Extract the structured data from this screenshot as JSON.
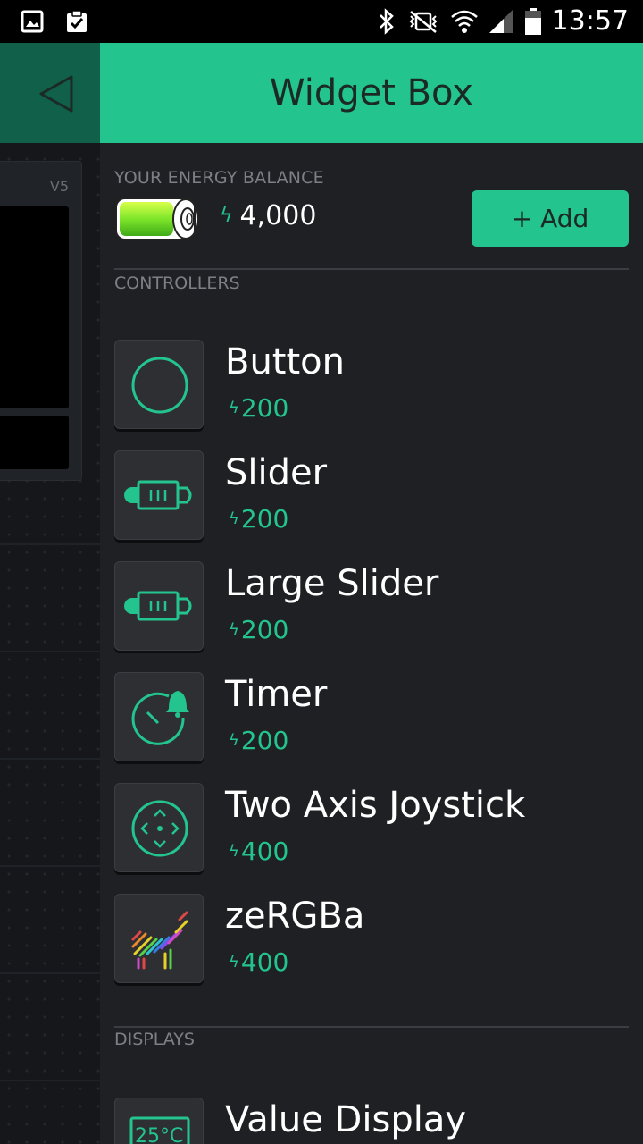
{
  "status_bar": {
    "time": "13:57",
    "icons": [
      "gallery-icon",
      "clipboard-check-icon",
      "bluetooth-icon",
      "vibrate-mute-icon",
      "wifi-icon",
      "signal-icon",
      "battery-icon"
    ]
  },
  "background_dashboard": {
    "pin_label": "V5"
  },
  "panel": {
    "title": "Widget Box",
    "energy": {
      "label": "YOUR ENERGY BALANCE",
      "value": "4,000",
      "add_label": "+ Add"
    },
    "controllers": {
      "label": "CONTROLLERS",
      "items": [
        {
          "name": "Button",
          "cost": "200",
          "icon": "circle-button-icon"
        },
        {
          "name": "Slider",
          "cost": "200",
          "icon": "slider-icon"
        },
        {
          "name": "Large Slider",
          "cost": "200",
          "icon": "large-slider-icon"
        },
        {
          "name": "Timer",
          "cost": "200",
          "icon": "timer-bell-icon"
        },
        {
          "name": "Two Axis Joystick",
          "cost": "400",
          "icon": "joystick-icon"
        },
        {
          "name": "zeRGBa",
          "cost": "400",
          "icon": "zebra-rgb-icon"
        }
      ]
    },
    "displays": {
      "label": "DISPLAYS",
      "items": [
        {
          "name": "Value Display",
          "cost": "",
          "icon": "value-display-icon",
          "icon_text": "25°C"
        }
      ]
    }
  },
  "colors": {
    "accent": "#23c48e",
    "panel_bg": "#1f2023",
    "tile_bg": "#2d2f33"
  }
}
